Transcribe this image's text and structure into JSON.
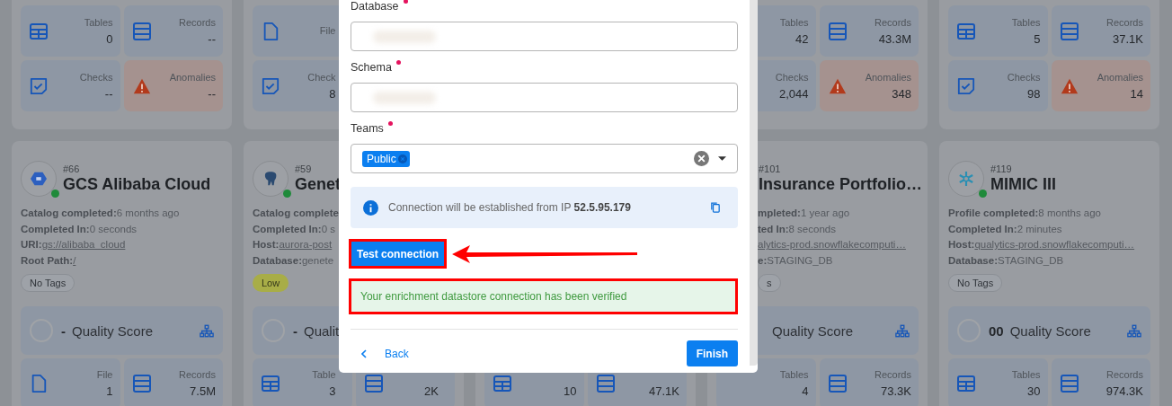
{
  "top_cards": [
    {
      "tiles": [
        {
          "kind": "tables",
          "label": "Tables",
          "value": "0"
        },
        {
          "kind": "records",
          "label": "Records",
          "value": "--"
        },
        {
          "kind": "checks",
          "label": "Checks",
          "value": "--"
        },
        {
          "kind": "anomalies",
          "label": "Anomalies",
          "value": "--"
        }
      ]
    },
    {
      "tiles": [
        {
          "kind": "files",
          "label": "File"
        },
        {
          "kind": "checks",
          "label": "Check",
          "value": "8"
        }
      ]
    },
    {
      "tiles": [
        {
          "label": "Tables",
          "value": "42"
        },
        {
          "kind": "records",
          "label": "Records",
          "value": "43.3M"
        },
        {
          "label": "Checks",
          "value": "2,044"
        },
        {
          "kind": "anomalies",
          "label": "Anomalies",
          "value": "348"
        }
      ]
    },
    {
      "tiles": [
        {
          "kind": "tables",
          "label": "Tables",
          "value": "5"
        },
        {
          "kind": "records",
          "label": "Records",
          "value": "37.1K"
        },
        {
          "kind": "checks",
          "label": "Checks",
          "value": "98"
        },
        {
          "kind": "anomalies",
          "label": "Anomalies",
          "value": "14"
        }
      ]
    }
  ],
  "cards": [
    {
      "avatar": {
        "kind": "gcs"
      },
      "online": true,
      "number": "#66",
      "title": "GCS Alibaba Cloud",
      "lines": [
        {
          "label": "Catalog completed:",
          "value": "6 months ago",
          "link": false
        },
        {
          "label": "Completed In:",
          "value": "0 seconds",
          "link": false
        },
        {
          "label": "URI:",
          "value": "gs://alibaba_cloud",
          "link": true
        },
        {
          "label": "Root Path:",
          "value": "/",
          "link": true
        }
      ],
      "tag": {
        "kind": "none",
        "label": "No Tags"
      },
      "score": {
        "value": "-",
        "label": "Quality Score"
      },
      "tiles": [
        {
          "kind": "files",
          "label": "File",
          "value": "1"
        },
        {
          "kind": "records",
          "label": "Records",
          "value": "7.5M"
        }
      ]
    },
    {
      "avatar": {
        "kind": "postgres"
      },
      "online": true,
      "number": "#59",
      "title": "Genet",
      "lines": [
        {
          "label": "Catalog complete"
        },
        {
          "label": "Completed In:",
          "value": "0 s",
          "link": false
        },
        {
          "label": "Host:",
          "value": "aurora-post",
          "link": true
        },
        {
          "label": "Database:",
          "value": "genete",
          "link": false
        }
      ],
      "tag": {
        "kind": "low",
        "label": "Low"
      },
      "score": {
        "value": "-",
        "label": "Qualit"
      },
      "tiles": [
        {
          "kind": "tables",
          "label": "Table",
          "value": "3"
        },
        {
          "kind": "records",
          "value": "2K"
        }
      ]
    },
    {
      "tiles": [
        {
          "kind": "tables",
          "value": "10"
        },
        {
          "kind": "records",
          "value": "47.1K"
        }
      ]
    },
    {
      "number": "#101",
      "title": "Insurance Portfolio…",
      "lines": [
        {
          "label": "mpleted:",
          "value": "1 year ago",
          "link": false
        },
        {
          "label": "ted In:",
          "value": "8 seconds",
          "link": false
        },
        {
          "value": "alytics-prod.snowflakecomputi…",
          "link": true
        },
        {
          "label": "e:",
          "value": "STAGING_DB",
          "link": false
        }
      ],
      "tag": {
        "kind": "none",
        "label": "s"
      },
      "score": {
        "label": "Quality Score"
      },
      "tiles": [
        {
          "label": "Tables",
          "value": "4"
        },
        {
          "kind": "records",
          "label": "Records",
          "value": "73.3K"
        }
      ]
    },
    {
      "avatar": {
        "kind": "snowflake"
      },
      "online": true,
      "number": "#119",
      "title": "MIMIC III",
      "lines": [
        {
          "label": "Profile completed:",
          "value": "8 months ago",
          "link": false
        },
        {
          "label": "Completed In:",
          "value": "2 minutes",
          "link": false
        },
        {
          "label": "Host:",
          "value": "qualytics-prod.snowflakecomputi…",
          "link": true
        },
        {
          "label": "Database:",
          "value": "STAGING_DB",
          "link": false
        }
      ],
      "tag": {
        "kind": "none",
        "label": "No Tags"
      },
      "score": {
        "value": "00",
        "label": "Quality Score"
      },
      "tiles": [
        {
          "kind": "tables",
          "label": "Tables",
          "value": "30"
        },
        {
          "kind": "records",
          "label": "Records",
          "value": "974.3K"
        }
      ]
    }
  ],
  "modal": {
    "fields": [
      {
        "label": "Database",
        "required": true
      },
      {
        "label": "Schema",
        "required": true
      }
    ],
    "teams": {
      "label": "Teams",
      "required": true,
      "chips": [
        "Public"
      ]
    },
    "info": "Connection will be established from IP **52.5.95.179**",
    "test_button": {
      "label": "Test connection",
      "highlighted": true
    },
    "message": {
      "text": "Your enrichment datastore connection has been verified",
      "highlighted": true
    },
    "back": "Back",
    "finish": "Finish"
  }
}
